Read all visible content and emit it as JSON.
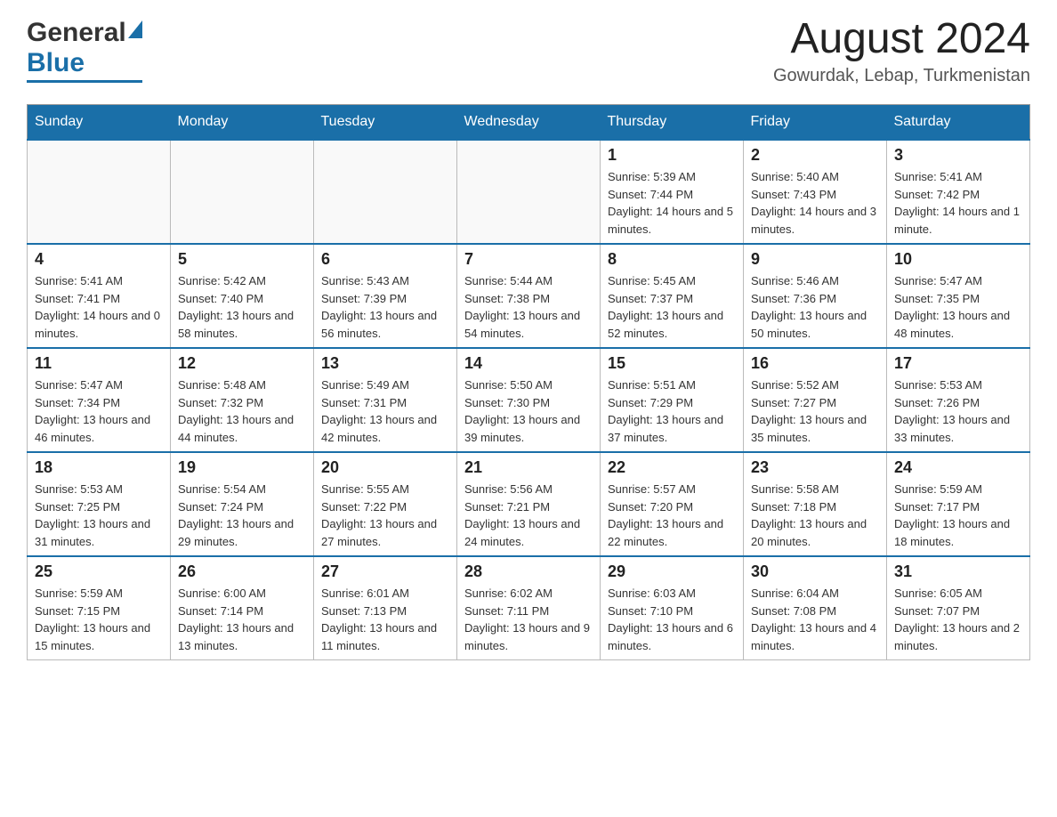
{
  "header": {
    "logo_general": "General",
    "logo_blue": "Blue",
    "month_year": "August 2024",
    "location": "Gowurdak, Lebap, Turkmenistan"
  },
  "weekdays": [
    "Sunday",
    "Monday",
    "Tuesday",
    "Wednesday",
    "Thursday",
    "Friday",
    "Saturday"
  ],
  "weeks": [
    [
      {
        "day": "",
        "info": ""
      },
      {
        "day": "",
        "info": ""
      },
      {
        "day": "",
        "info": ""
      },
      {
        "day": "",
        "info": ""
      },
      {
        "day": "1",
        "info": "Sunrise: 5:39 AM\nSunset: 7:44 PM\nDaylight: 14 hours and 5 minutes."
      },
      {
        "day": "2",
        "info": "Sunrise: 5:40 AM\nSunset: 7:43 PM\nDaylight: 14 hours and 3 minutes."
      },
      {
        "day": "3",
        "info": "Sunrise: 5:41 AM\nSunset: 7:42 PM\nDaylight: 14 hours and 1 minute."
      }
    ],
    [
      {
        "day": "4",
        "info": "Sunrise: 5:41 AM\nSunset: 7:41 PM\nDaylight: 14 hours and 0 minutes."
      },
      {
        "day": "5",
        "info": "Sunrise: 5:42 AM\nSunset: 7:40 PM\nDaylight: 13 hours and 58 minutes."
      },
      {
        "day": "6",
        "info": "Sunrise: 5:43 AM\nSunset: 7:39 PM\nDaylight: 13 hours and 56 minutes."
      },
      {
        "day": "7",
        "info": "Sunrise: 5:44 AM\nSunset: 7:38 PM\nDaylight: 13 hours and 54 minutes."
      },
      {
        "day": "8",
        "info": "Sunrise: 5:45 AM\nSunset: 7:37 PM\nDaylight: 13 hours and 52 minutes."
      },
      {
        "day": "9",
        "info": "Sunrise: 5:46 AM\nSunset: 7:36 PM\nDaylight: 13 hours and 50 minutes."
      },
      {
        "day": "10",
        "info": "Sunrise: 5:47 AM\nSunset: 7:35 PM\nDaylight: 13 hours and 48 minutes."
      }
    ],
    [
      {
        "day": "11",
        "info": "Sunrise: 5:47 AM\nSunset: 7:34 PM\nDaylight: 13 hours and 46 minutes."
      },
      {
        "day": "12",
        "info": "Sunrise: 5:48 AM\nSunset: 7:32 PM\nDaylight: 13 hours and 44 minutes."
      },
      {
        "day": "13",
        "info": "Sunrise: 5:49 AM\nSunset: 7:31 PM\nDaylight: 13 hours and 42 minutes."
      },
      {
        "day": "14",
        "info": "Sunrise: 5:50 AM\nSunset: 7:30 PM\nDaylight: 13 hours and 39 minutes."
      },
      {
        "day": "15",
        "info": "Sunrise: 5:51 AM\nSunset: 7:29 PM\nDaylight: 13 hours and 37 minutes."
      },
      {
        "day": "16",
        "info": "Sunrise: 5:52 AM\nSunset: 7:27 PM\nDaylight: 13 hours and 35 minutes."
      },
      {
        "day": "17",
        "info": "Sunrise: 5:53 AM\nSunset: 7:26 PM\nDaylight: 13 hours and 33 minutes."
      }
    ],
    [
      {
        "day": "18",
        "info": "Sunrise: 5:53 AM\nSunset: 7:25 PM\nDaylight: 13 hours and 31 minutes."
      },
      {
        "day": "19",
        "info": "Sunrise: 5:54 AM\nSunset: 7:24 PM\nDaylight: 13 hours and 29 minutes."
      },
      {
        "day": "20",
        "info": "Sunrise: 5:55 AM\nSunset: 7:22 PM\nDaylight: 13 hours and 27 minutes."
      },
      {
        "day": "21",
        "info": "Sunrise: 5:56 AM\nSunset: 7:21 PM\nDaylight: 13 hours and 24 minutes."
      },
      {
        "day": "22",
        "info": "Sunrise: 5:57 AM\nSunset: 7:20 PM\nDaylight: 13 hours and 22 minutes."
      },
      {
        "day": "23",
        "info": "Sunrise: 5:58 AM\nSunset: 7:18 PM\nDaylight: 13 hours and 20 minutes."
      },
      {
        "day": "24",
        "info": "Sunrise: 5:59 AM\nSunset: 7:17 PM\nDaylight: 13 hours and 18 minutes."
      }
    ],
    [
      {
        "day": "25",
        "info": "Sunrise: 5:59 AM\nSunset: 7:15 PM\nDaylight: 13 hours and 15 minutes."
      },
      {
        "day": "26",
        "info": "Sunrise: 6:00 AM\nSunset: 7:14 PM\nDaylight: 13 hours and 13 minutes."
      },
      {
        "day": "27",
        "info": "Sunrise: 6:01 AM\nSunset: 7:13 PM\nDaylight: 13 hours and 11 minutes."
      },
      {
        "day": "28",
        "info": "Sunrise: 6:02 AM\nSunset: 7:11 PM\nDaylight: 13 hours and 9 minutes."
      },
      {
        "day": "29",
        "info": "Sunrise: 6:03 AM\nSunset: 7:10 PM\nDaylight: 13 hours and 6 minutes."
      },
      {
        "day": "30",
        "info": "Sunrise: 6:04 AM\nSunset: 7:08 PM\nDaylight: 13 hours and 4 minutes."
      },
      {
        "day": "31",
        "info": "Sunrise: 6:05 AM\nSunset: 7:07 PM\nDaylight: 13 hours and 2 minutes."
      }
    ]
  ]
}
